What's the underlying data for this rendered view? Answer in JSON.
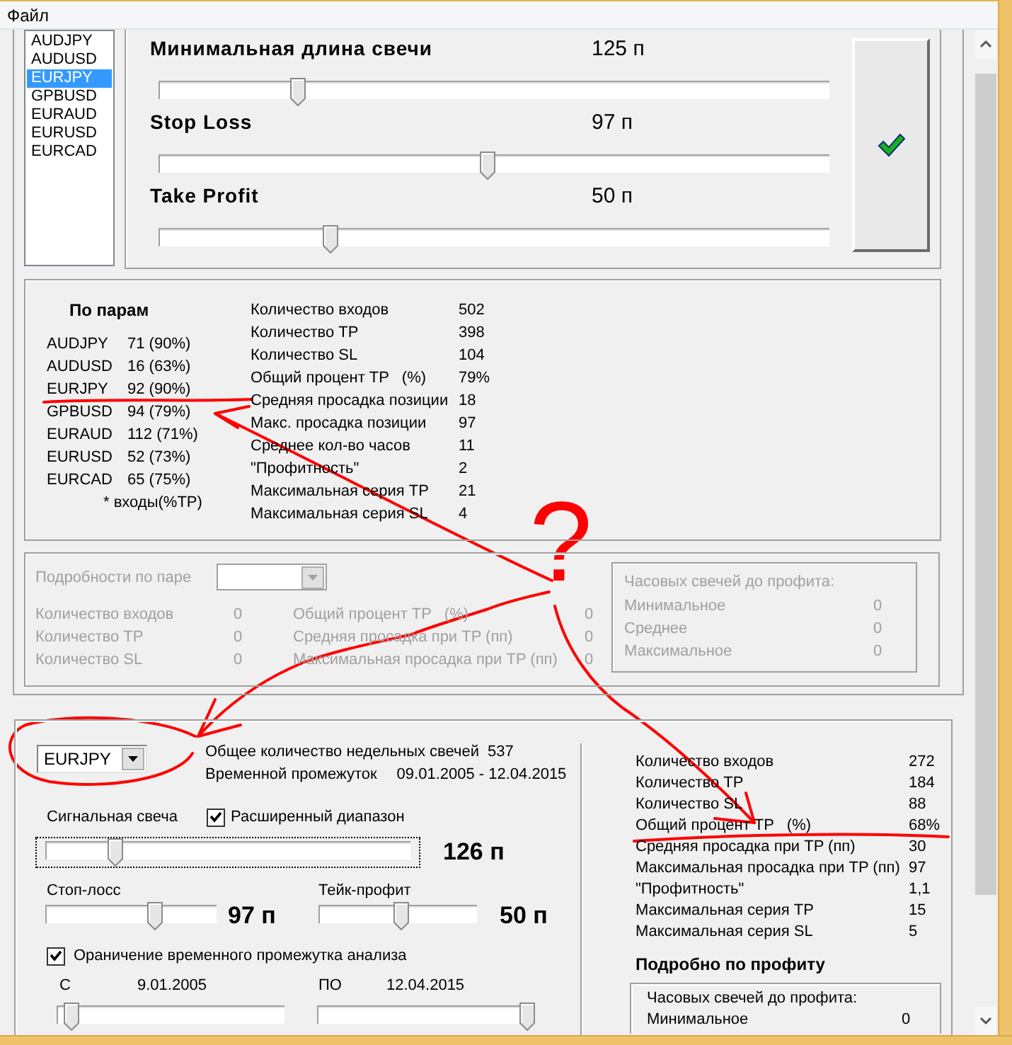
{
  "menu": [
    {
      "label": "Файл"
    }
  ],
  "pairs_list": [
    {
      "label": "AUDJPY",
      "selected": false
    },
    {
      "label": "AUDUSD",
      "selected": false
    },
    {
      "label": "EURJPY",
      "selected": true
    },
    {
      "label": "GPBUSD",
      "selected": false
    },
    {
      "label": "EURAUD",
      "selected": false
    },
    {
      "label": "EURUSD",
      "selected": false
    },
    {
      "label": "EURCAD",
      "selected": false
    }
  ],
  "parameters": [
    {
      "label": "Минимальная длина свечи",
      "value": "125 п",
      "level": 0.2
    },
    {
      "label": "Stop Loss",
      "value": "97 п",
      "level": 0.49
    },
    {
      "label": "Take Profit",
      "value": "50 п",
      "level": 0.25
    }
  ],
  "by_pairs": {
    "title": "По парам",
    "rows": [
      {
        "pair": "AUDJPY",
        "value": "71 (90%)"
      },
      {
        "pair": "AUDUSD",
        "value": "16 (63%)"
      },
      {
        "pair": "EURJPY",
        "value": "92 (90%)"
      },
      {
        "pair": "GPBUSD",
        "value": "94 (79%)"
      },
      {
        "pair": "EURAUD",
        "value": "112 (71%)"
      },
      {
        "pair": "EURUSD",
        "value": "52 (73%)"
      },
      {
        "pair": "EURCAD",
        "value": "65 (75%)"
      }
    ],
    "footnote": "* входы(%TP)"
  },
  "summary": [
    {
      "label": "Количество входов",
      "value": "502"
    },
    {
      "label": "Количество TP",
      "value": "398"
    },
    {
      "label": "Количество SL",
      "value": "104"
    },
    {
      "label": "Общий процент TP   (%)",
      "value": "79%"
    },
    {
      "label": "Средняя просадка позиции",
      "value": "18"
    },
    {
      "label": "Макс. просадка позиции",
      "value": "97"
    },
    {
      "label": "Среднее кол-во часов",
      "value": "11"
    },
    {
      "label": "\"Профитность\"",
      "value": "2"
    },
    {
      "label": "Максимальная серия TP",
      "value": "21"
    },
    {
      "label": "Максимальная серия SL",
      "value": "4"
    }
  ],
  "pair_details": {
    "disabled": true,
    "label": "Подробности по паре",
    "stats": [
      {
        "label": "Количество входов",
        "value": "0"
      },
      {
        "label": "Количество TP",
        "value": "0"
      },
      {
        "label": "Количество SL",
        "value": "0"
      }
    ],
    "stats_2": [
      {
        "label": "Общий процент TP   (%)",
        "value": "0"
      },
      {
        "label": "Средняя просадка при TP (пп)",
        "value": "0"
      },
      {
        "label": "Максимальная просадка при TP (пп)",
        "value": "0"
      }
    ],
    "profit_hours": {
      "title": "Часовых свечей до профита:",
      "rows": [
        {
          "label": "Минимальное",
          "value": "0"
        },
        {
          "label": "Среднее",
          "value": "0"
        },
        {
          "label": "Максимальное",
          "value": "0"
        }
      ]
    }
  },
  "analysis": {
    "pair": "EURJPY",
    "info": [
      {
        "label": "Общее количество недельных свечей",
        "value": "537"
      },
      {
        "label": "Временной промежуток",
        "value": "09.01.2005 - 12.04.2015"
      }
    ],
    "signal_candle": {
      "label": "Сигнальная свеча",
      "level": 0.18,
      "focused": true,
      "value": "126 п"
    },
    "extended_range": {
      "label": "Расширенный диапазон",
      "checked": true
    },
    "stop_loss": {
      "label": "Стоп-лосс",
      "level": 0.65,
      "value": "97 п"
    },
    "take_profit": {
      "label": "Тейк-профит",
      "level": 0.52,
      "value": "50 п"
    },
    "limit_period": {
      "label": "Ораничение временного промежутка анализа",
      "checked": true
    },
    "range": [
      {
        "label": "С",
        "value": "9.01.2005",
        "level": 0.03
      },
      {
        "label": "ПО",
        "value": "12.04.2015",
        "level": 1
      }
    ],
    "stats": [
      {
        "label": "Количество входов",
        "value": "272"
      },
      {
        "label": "Количество TP",
        "value": "184"
      },
      {
        "label": "Количество SL",
        "value": "88"
      },
      {
        "label": "Общий процент TP   (%)",
        "value": "68%"
      },
      {
        "label": "Средняя просадка при TP (пп)",
        "value": "30"
      },
      {
        "label": "Максимальная просадка при TP (пп)",
        "value": "97"
      },
      {
        "label": "\"Профитность\"",
        "value": "1,1"
      },
      {
        "label": "Максимальная серия TP",
        "value": "15"
      },
      {
        "label": "Максимальная серия SL",
        "value": "5"
      }
    ],
    "profit_title": "Подробно по профиту",
    "profit_hours": {
      "title": "Часовых свечей до профита:",
      "rows": [
        {
          "label": "Минимальное",
          "value": "0"
        }
      ]
    }
  },
  "annotation": {
    "mark": "?"
  }
}
